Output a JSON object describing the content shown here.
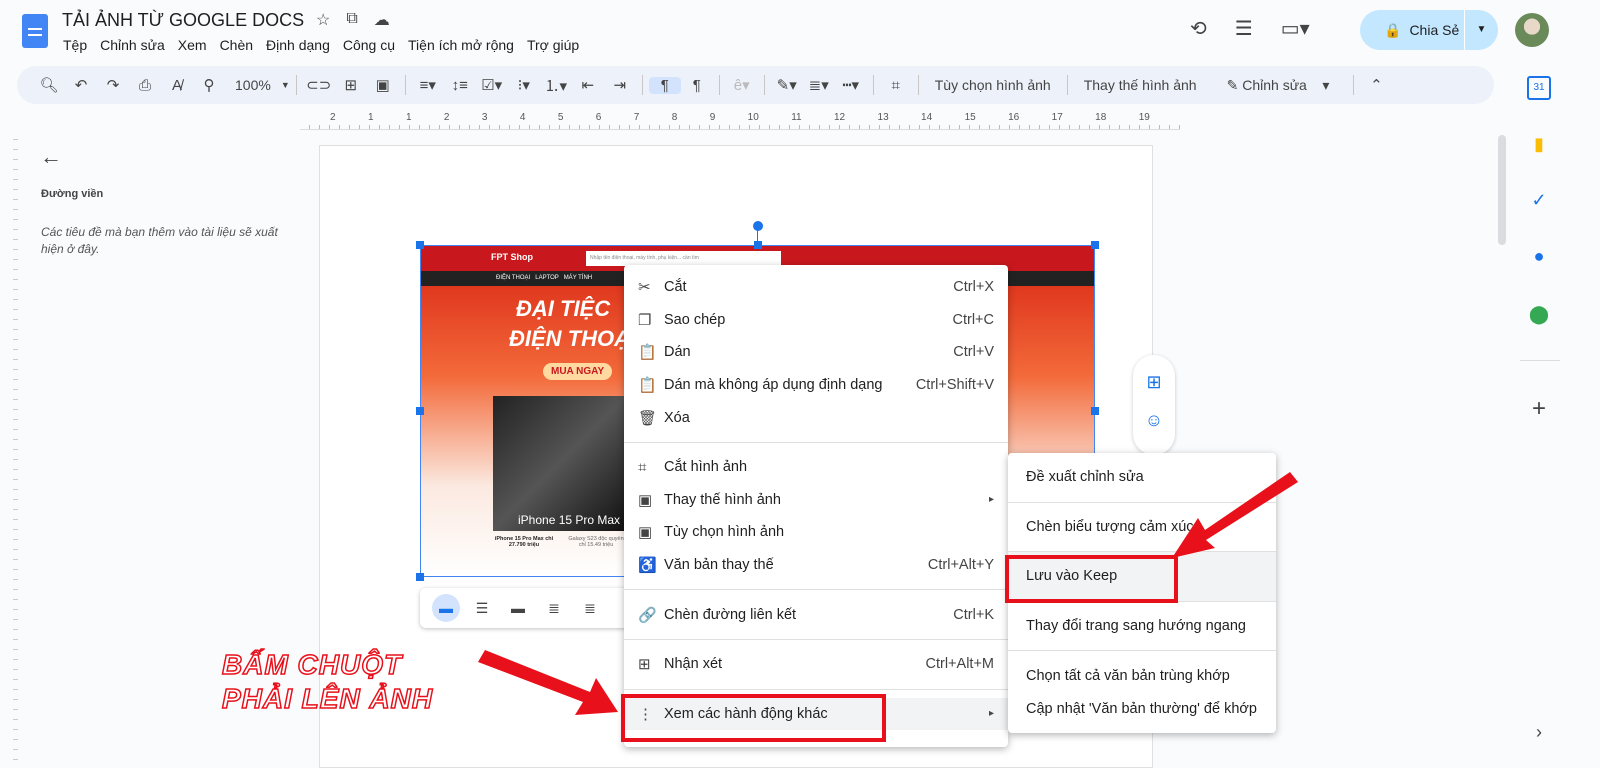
{
  "header": {
    "title": "TẢI ẢNH TỪ GOOGLE DOCS",
    "menus": [
      "Tệp",
      "Chỉnh sửa",
      "Xem",
      "Chèn",
      "Định dạng",
      "Công cụ",
      "Tiện ích mở rộng",
      "Trợ giúp"
    ],
    "share_label": "Chia Sẻ"
  },
  "toolbar": {
    "zoom": "100%",
    "image_options": "Tùy chọn hình ảnh",
    "replace_image": "Thay thế hình ảnh",
    "edit_mode": "Chỉnh sửa"
  },
  "ruler": [
    "2",
    "1",
    "1",
    "2",
    "3",
    "4",
    "5",
    "6",
    "7",
    "8",
    "9",
    "10",
    "11",
    "12",
    "13",
    "14",
    "15",
    "16",
    "17",
    "18",
    "19"
  ],
  "outline": {
    "title": "Đường viền",
    "placeholder": "Các tiêu đề mà bạn thêm vào tài liệu sẽ xuất hiện ở đây."
  },
  "context_menu": {
    "items": [
      {
        "label": "Cắt",
        "shortcut": "Ctrl+X",
        "icon": "✂"
      },
      {
        "label": "Sao chép",
        "shortcut": "Ctrl+C",
        "icon": "❐"
      },
      {
        "label": "Dán",
        "shortcut": "Ctrl+V",
        "icon": "📋"
      },
      {
        "label": "Dán mà không áp dụng định dạng",
        "shortcut": "Ctrl+Shift+V",
        "icon": "📋"
      },
      {
        "label": "Xóa",
        "shortcut": "",
        "icon": "🗑"
      },
      {
        "label": "Cắt hình ảnh",
        "shortcut": "",
        "icon": "⌗"
      },
      {
        "label": "Thay thế hình ảnh",
        "shortcut": "▸",
        "icon": "▣"
      },
      {
        "label": "Tùy chọn hình ảnh",
        "shortcut": "",
        "icon": "▣"
      },
      {
        "label": "Văn bản thay thế",
        "shortcut": "Ctrl+Alt+Y",
        "icon": "♿"
      },
      {
        "label": "Chèn đường liên kết",
        "shortcut": "Ctrl+K",
        "icon": "🔗"
      },
      {
        "label": "Nhận xét",
        "shortcut": "Ctrl+Alt+M",
        "icon": "⊞"
      },
      {
        "label": "Xem các hành động khác",
        "shortcut": "▸",
        "icon": "⋮"
      }
    ]
  },
  "submenu": {
    "items": [
      "Đề xuất chỉnh sửa",
      "Chèn biểu tượng cảm xúc",
      "Lưu vào Keep",
      "Thay đổi trang sang hướng ngang",
      "Chọn tất cả văn bản trùng khớp",
      "Cập nhật 'Văn bản thường' để khớp"
    ]
  },
  "annotation": {
    "line1": "BẤM CHUỘT",
    "line2": "PHẢI LÊN ẢNH"
  },
  "image": {
    "banner1": "ĐẠI TIỆC",
    "banner2": "ĐIỆN THOẠI",
    "cta": "MUA NGAY",
    "product": "iPhone 15 Pro Max",
    "price": "iPhone 15 Pro Max chỉ 27.790 triệu",
    "price2": "Galaxy S23 độc quyền chỉ 15.49 triệu",
    "search_placeholder": "Nhập tên điện thoại, máy tính, phụ kiện... cần tìm",
    "nav": "ĐIỆN THOẠI   LAPTOP   MÁY TÍNH"
  },
  "colors": {
    "accent": "#1a73e8",
    "share_bg": "#c2e7ff",
    "annotation": "#e8101a"
  }
}
